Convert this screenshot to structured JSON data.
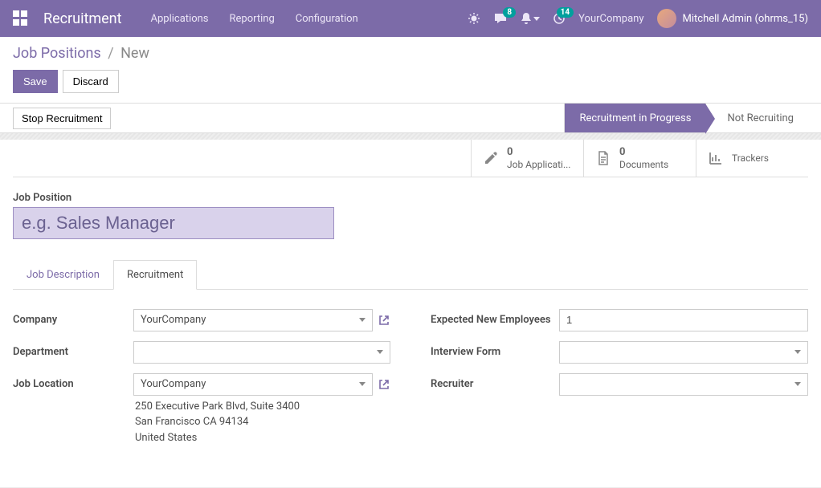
{
  "navbar": {
    "brand": "Recruitment",
    "menu": [
      "Applications",
      "Reporting",
      "Configuration"
    ],
    "messages_badge": "8",
    "activities_badge": "14",
    "company": "YourCompany",
    "user": "Mitchell Admin (ohrms_15)"
  },
  "breadcrumb": {
    "parent": "Job Positions",
    "current": "New"
  },
  "buttons": {
    "save": "Save",
    "discard": "Discard",
    "stop_recruitment": "Stop Recruitment"
  },
  "stages": {
    "active": "Recruitment in Progress",
    "inactive": "Not Recruiting"
  },
  "stats": {
    "applications": {
      "count": "0",
      "label": "Job Applicati..."
    },
    "documents": {
      "count": "0",
      "label": "Documents"
    },
    "trackers": {
      "label": "Trackers"
    }
  },
  "form": {
    "job_position_label": "Job Position",
    "job_position_placeholder": "e.g. Sales Manager",
    "tabs": [
      "Job Description",
      "Recruitment"
    ],
    "left": {
      "company_label": "Company",
      "company_value": "YourCompany",
      "department_label": "Department",
      "department_value": "",
      "job_location_label": "Job Location",
      "job_location_value": "YourCompany",
      "address_line1": "250 Executive Park Blvd, Suite 3400",
      "address_line2": "San Francisco CA 94134",
      "address_country": "United States"
    },
    "right": {
      "expected_label": "Expected New Employees",
      "expected_value": "1",
      "interview_label": "Interview Form",
      "interview_value": "",
      "recruiter_label": "Recruiter",
      "recruiter_value": ""
    }
  }
}
